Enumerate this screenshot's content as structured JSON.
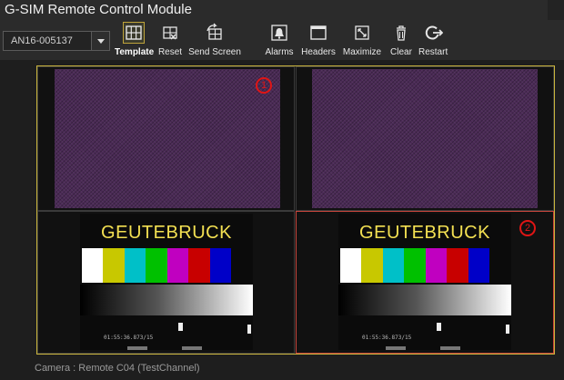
{
  "window": {
    "title": "G-SIM Remote Control Module"
  },
  "device_select": {
    "value": "AN16-005137"
  },
  "toolbar": [
    {
      "id": "template",
      "label": "Template",
      "icon": "grid-icon",
      "active": true
    },
    {
      "id": "reset",
      "label": "Reset",
      "icon": "reset-icon",
      "active": false
    },
    {
      "id": "send",
      "label": "Send Screen",
      "icon": "send-screen-icon",
      "active": false
    },
    {
      "id": "alarms",
      "label": "Alarms",
      "icon": "bell-icon",
      "active": false
    },
    {
      "id": "headers",
      "label": "Headers",
      "icon": "window-icon",
      "active": false
    },
    {
      "id": "maximize",
      "label": "Maximize",
      "icon": "maximize-icon",
      "active": false
    },
    {
      "id": "clear",
      "label": "Clear",
      "icon": "trash-icon",
      "active": false
    },
    {
      "id": "restart",
      "label": "Restart",
      "icon": "restart-icon",
      "active": false
    }
  ],
  "tiles": [
    {
      "number": "1",
      "content": "noise",
      "selected": false
    },
    {
      "number": "",
      "content": "noise",
      "selected": false
    },
    {
      "number": "",
      "content": "testcard",
      "selected": false
    },
    {
      "number": "2",
      "content": "testcard",
      "selected": true
    }
  ],
  "testcard": {
    "brand": "GEUTEBRUCK",
    "timestamp": "01:55:36.873/15",
    "bar_colors": [
      "#ffffff",
      "#c8c800",
      "#00c0c8",
      "#00c000",
      "#c000c0",
      "#c80000",
      "#0000c8"
    ]
  },
  "colors": {
    "accent": "#c9b43c",
    "selected_border": "#c8463c",
    "annotation": "#e01515"
  },
  "status": {
    "text": "Camera : Remote C04 (TestChannel)"
  }
}
